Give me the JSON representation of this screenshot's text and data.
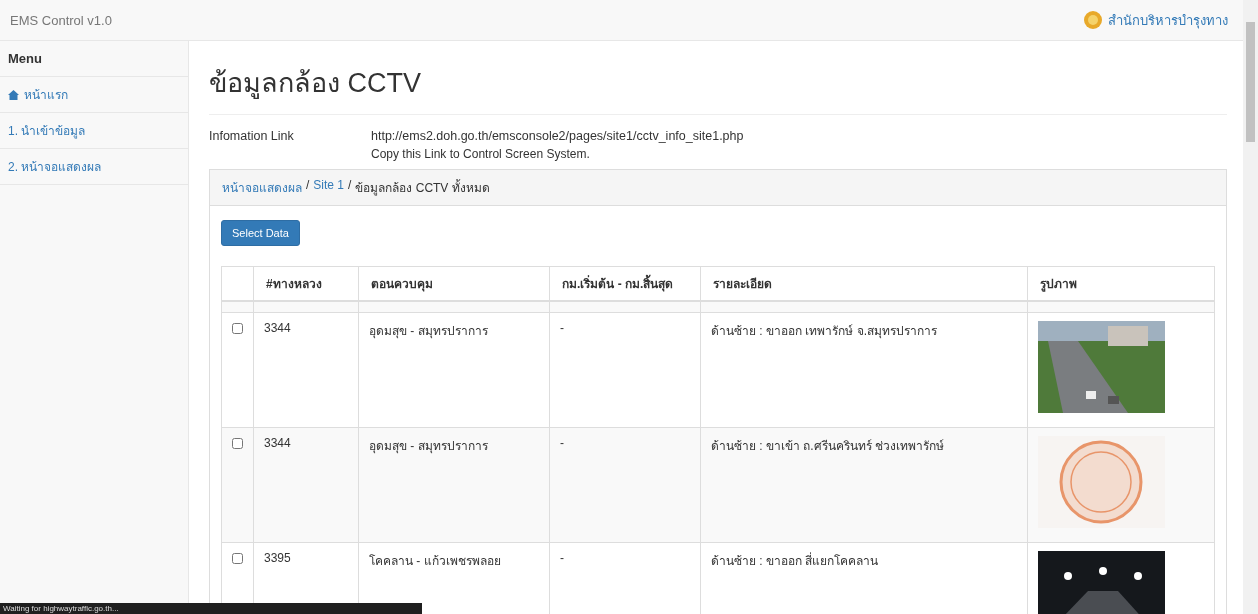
{
  "navbar": {
    "brand": "EMS Control v1.0",
    "org": "สำนักบริหารบำรุงทาง"
  },
  "sidebar": {
    "title": "Menu",
    "items": [
      {
        "label": "หน้าแรก",
        "kind": "home"
      },
      {
        "label": "1. นำเข้าข้อมูล",
        "kind": "plain"
      },
      {
        "label": "2. หน้าจอแสดงผล",
        "kind": "plain"
      }
    ]
  },
  "page": {
    "title": "ข้อมูลกล้อง CCTV",
    "info_label": "Infomation Link",
    "info_url": "http://ems2.doh.go.th/emsconsole2/pages/site1/cctv_info_site1.php",
    "info_note": "Copy this Link to Control Screen System."
  },
  "breadcrumb": [
    {
      "label": "หน้าจอแสดงผล",
      "kind": "link"
    },
    {
      "label": "/",
      "kind": "separator"
    },
    {
      "label": "Site 1",
      "kind": "link"
    },
    {
      "label": "/",
      "kind": "separator"
    },
    {
      "label": "ข้อมูลกล้อง CCTV ทั้งหมด",
      "kind": "current"
    }
  ],
  "select_button": "Select Data",
  "table": {
    "columns": [
      "#ทางหลวง",
      "ตอนควบคุม",
      "กม.เริ่มต้น - กม.สิ้นสุด",
      "รายละเอียด",
      "รูปภาพ"
    ],
    "rows": [
      {
        "checked": false,
        "highway": "3344",
        "section": "อุดมสุข - สมุทรปราการ",
        "km": "-",
        "detail": "ด้านซ้าย : ขาออก เทพารักษ์ จ.สมุทรปราการ",
        "kind": "day"
      },
      {
        "checked": false,
        "highway": "3344",
        "section": "อุดมสุข - สมุทรปราการ",
        "km": "-",
        "detail": "ด้านซ้าย : ขาเข้า ถ.ศรีนครินทร์ ช่วงเทพารักษ์",
        "kind": "stamp"
      },
      {
        "checked": false,
        "highway": "3395",
        "section": "โคคลาน - แก้วเพชรพลอย",
        "km": "-",
        "detail": "ด้านซ้าย : ขาออก สี่แยกโคคลาน",
        "kind": "night"
      }
    ]
  },
  "status_bar": "Waiting for highwaytraffic.go.th..."
}
